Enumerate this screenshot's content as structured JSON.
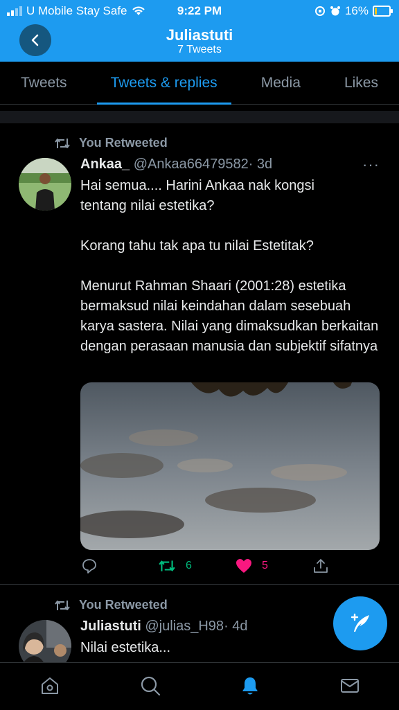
{
  "status_bar": {
    "carrier": "U Mobile Stay Safe",
    "time": "9:22 PM",
    "battery": "16%",
    "battery_level": 0.16
  },
  "header": {
    "title": "Juliastuti",
    "subtitle": "7 Tweets"
  },
  "tabs": [
    {
      "label": "Tweets"
    },
    {
      "label": "Tweets & replies"
    },
    {
      "label": "Media"
    },
    {
      "label": "Likes"
    }
  ],
  "tweets": [
    {
      "retweet_label": "You Retweeted",
      "name": "Ankaa_",
      "handle": "@Ankaa66479582",
      "time": "· 3d",
      "more": "···",
      "text": [
        "Hai semua.... Harini Ankaa nak kongsi tentang nilai estetika?",
        "Korang tahu tak apa tu nilai Estetitak?",
        "Menurut Rahman Shaari (2001:28) estetika bermaksud nilai keindahan dalam sesebuah karya sastera. Nilai yang dimaksudkan berkaitan dengan perasaan manusia dan subjektif sifatnya"
      ],
      "retweets": "6",
      "likes": "5"
    },
    {
      "retweet_label": "You Retweeted",
      "name": "Juliastuti",
      "handle": "@julias_H98",
      "time": "· 4d",
      "text": [
        "Nilai estetika..."
      ]
    }
  ],
  "colors": {
    "accent": "#1d9bf0",
    "retweet": "#00ba7c",
    "like": "#f91880"
  }
}
